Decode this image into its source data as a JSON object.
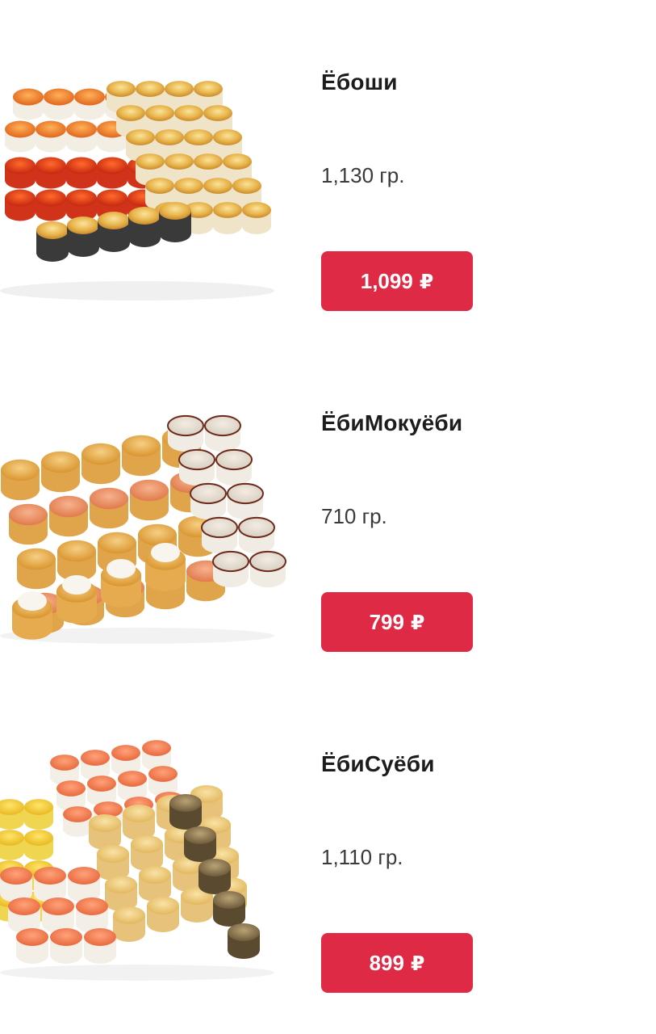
{
  "theme": {
    "accent": "#de2a45",
    "text": "#1c1c1c",
    "muted_text": "#3a3a3a",
    "background": "#ffffff"
  },
  "products": [
    {
      "name": "Ёбоши",
      "weight": "1,130 гр.",
      "price": "1,099",
      "currency": "₽",
      "image_icon": "sushi-set-baked-rolls-image"
    },
    {
      "name": "ЁбиМокуёби",
      "weight": "710 гр.",
      "price": "799",
      "currency": "₽",
      "image_icon": "sushi-set-tempura-rolls-image"
    },
    {
      "name": "ЁбиСуёби",
      "weight": "1,110 гр.",
      "price": "899",
      "currency": "₽",
      "image_icon": "sushi-set-mixed-rolls-image"
    }
  ]
}
